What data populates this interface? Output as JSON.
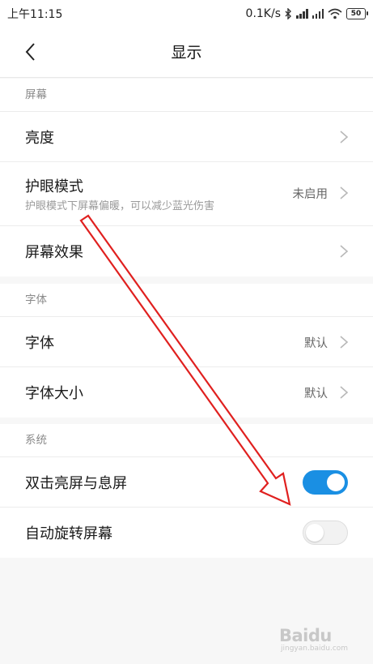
{
  "status_bar": {
    "time": "上午11:15",
    "network_speed": "0.1K/s",
    "battery": "50"
  },
  "header": {
    "title": "显示"
  },
  "sections": [
    {
      "header": "屏幕",
      "items": [
        {
          "label": "亮度"
        },
        {
          "label": "护眼模式",
          "sub": "护眼模式下屏幕偏暖，可以减少蓝光伤害",
          "value": "未启用"
        },
        {
          "label": "屏幕效果"
        }
      ]
    },
    {
      "header": "字体",
      "items": [
        {
          "label": "字体",
          "value": "默认"
        },
        {
          "label": "字体大小",
          "value": "默认"
        }
      ]
    },
    {
      "header": "系统",
      "items": [
        {
          "label": "双击亮屏与息屏",
          "toggle": true
        },
        {
          "label": "自动旋转屏幕",
          "toggle": false
        }
      ]
    }
  ],
  "colors": {
    "accent": "#1a8fe3",
    "annotation": "#e0201f"
  },
  "watermark": {
    "text": "Baidu",
    "sub": "jingyan.baidu.com"
  }
}
